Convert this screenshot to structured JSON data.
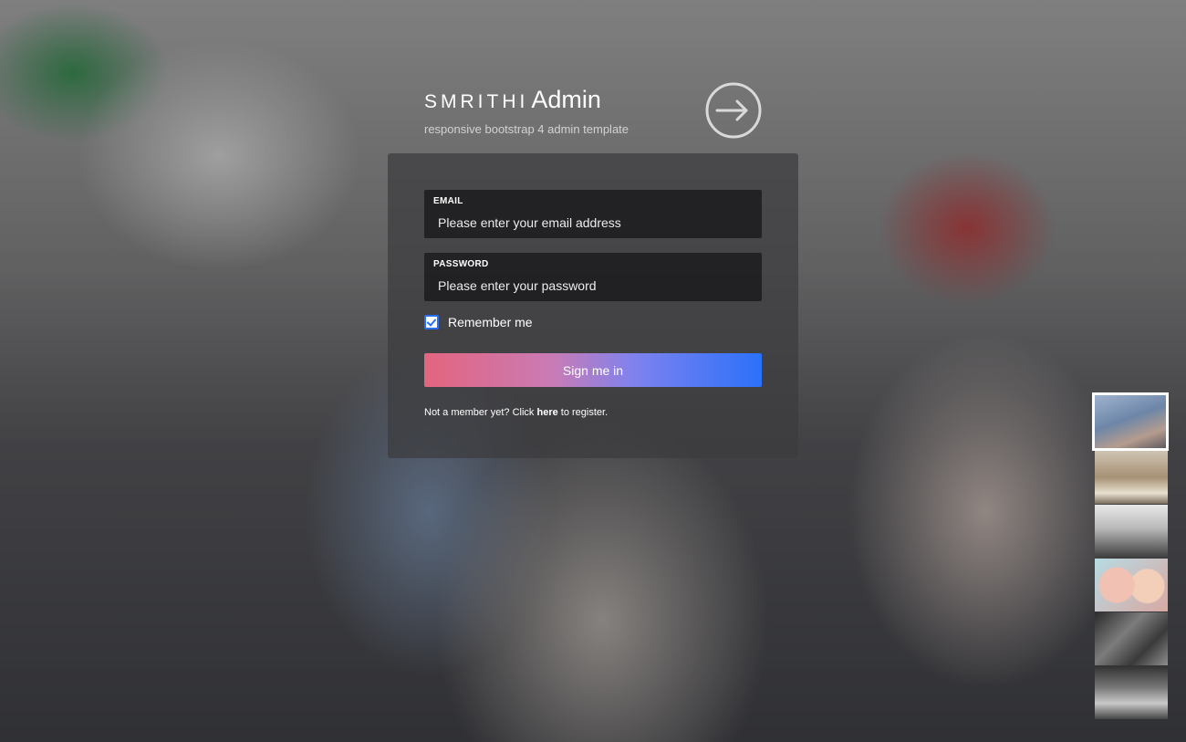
{
  "brand": {
    "name_part1": "SMRITHI",
    "name_part2": "Admin",
    "tagline": "responsive bootstrap 4 admin template"
  },
  "login_form": {
    "email": {
      "label": "EMAIL",
      "placeholder": "Please enter your email address",
      "value": ""
    },
    "password": {
      "label": "PASSWORD",
      "placeholder": "Please enter your password",
      "value": ""
    },
    "remember_me": {
      "label": "Remember me",
      "checked": true
    },
    "submit_label": "Sign me in",
    "register_prefix": "Not a member yet? Click ",
    "register_link": "here",
    "register_suffix": " to register."
  },
  "background_thumbnails": {
    "count": 6,
    "active_index": 0
  },
  "icons": {
    "login": "sign-in-icon",
    "check": "check-icon"
  },
  "colors": {
    "accent": "#2b71fa",
    "gradient_start": "#e3657f",
    "checkbox_border": "#2a6ff3"
  }
}
